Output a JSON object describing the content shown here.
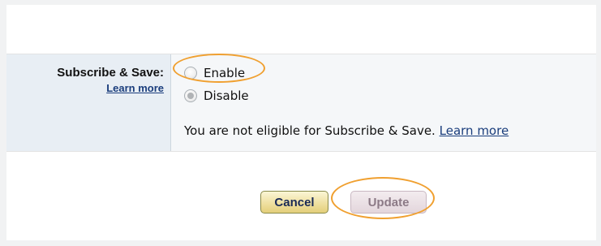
{
  "subscribe": {
    "title": "Subscribe & Save:",
    "learn_more": "Learn more",
    "options": [
      {
        "label": "Enable",
        "selected": false
      },
      {
        "label": "Disable",
        "selected": true
      }
    ],
    "note_text": "You are not eligible for Subscribe & Save.",
    "note_link": "Learn more"
  },
  "actions": {
    "cancel_label": "Cancel",
    "update_label": "Update"
  },
  "annotation": {
    "highlight_color": "#f0a030"
  }
}
